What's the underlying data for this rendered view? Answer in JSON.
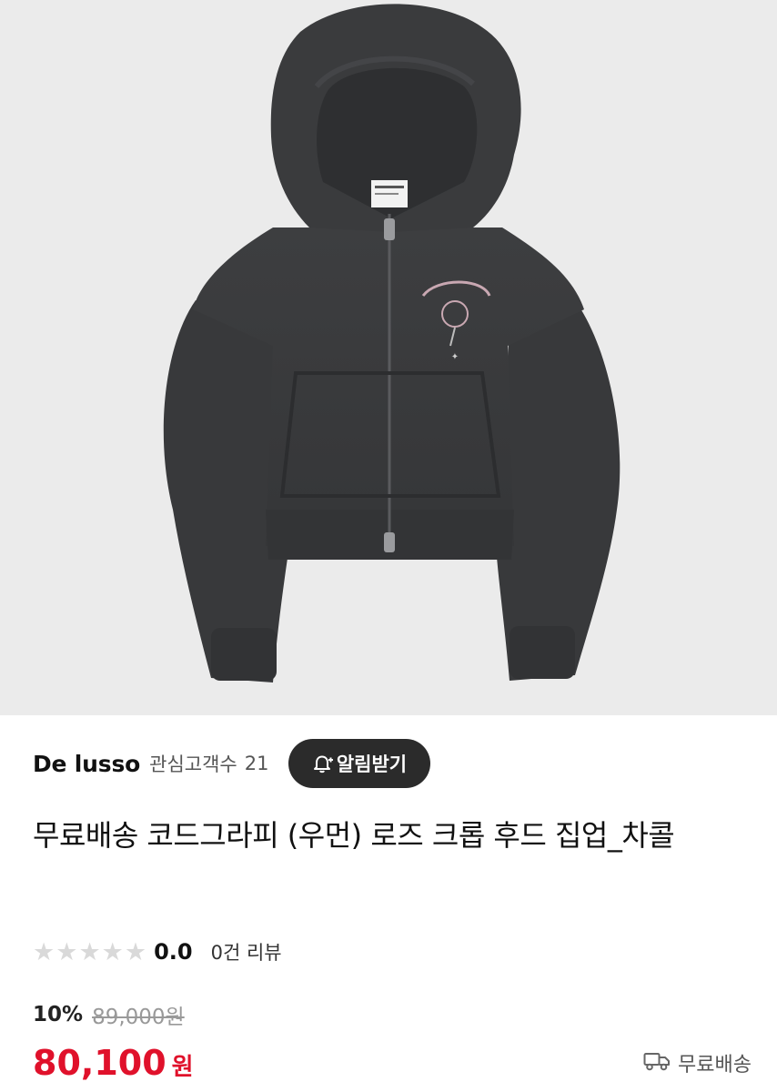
{
  "product": {
    "image_alt": "charcoal cropped zip-up hoodie",
    "title": "무료배송 코드그라피 (우먼) 로즈 크롭 후드 집업_차콜"
  },
  "store": {
    "name": "De lusso",
    "favorite_label": "관심고객수",
    "favorite_count": "21",
    "alarm_button": "알림받기"
  },
  "rating": {
    "score": "0.0",
    "reviews": "0건 리뷰",
    "stars_filled": 0,
    "stars_total": 5
  },
  "price": {
    "discount": "10%",
    "original": "89,000원",
    "final": "80,100",
    "currency": "원",
    "color": "#e0112b"
  },
  "shipping": {
    "label": "무료배송",
    "icon": "truck-icon"
  }
}
